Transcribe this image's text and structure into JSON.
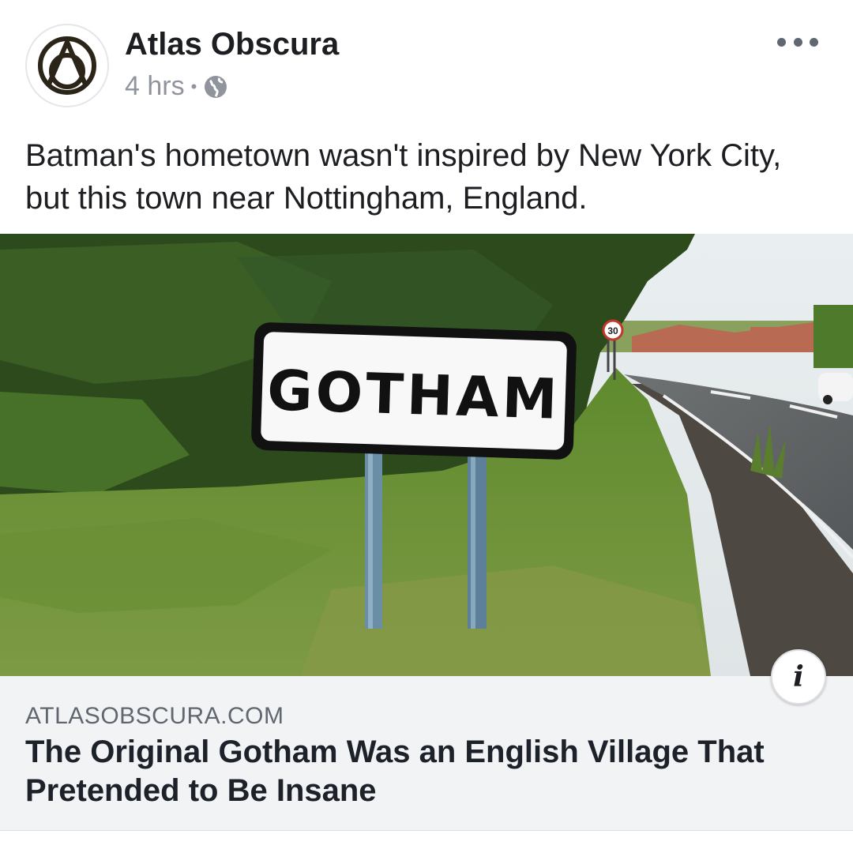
{
  "post": {
    "page_name": "Atlas Obscura",
    "timestamp": "4 hrs",
    "separator": "•",
    "audience_icon": "globe-icon",
    "more_icon": "more-options-icon",
    "text_line1": "Batman's hometown wasn't inspired by New York City,",
    "text_line2": "but this town near Nottingham, England."
  },
  "photo": {
    "sign_text": "GOTHAM",
    "speed_sign_text": "30"
  },
  "link": {
    "domain": "ATLASOBSCURA.COM",
    "headline_line1": "The Original Gotham Was an English Village That",
    "headline_line2": "Pretended to Be Insane",
    "info_label": "i"
  },
  "colors": {
    "name_text": "#1c1e21",
    "meta_text": "#90949c",
    "card_bg": "#f2f3f5",
    "domain_text": "#606770"
  }
}
